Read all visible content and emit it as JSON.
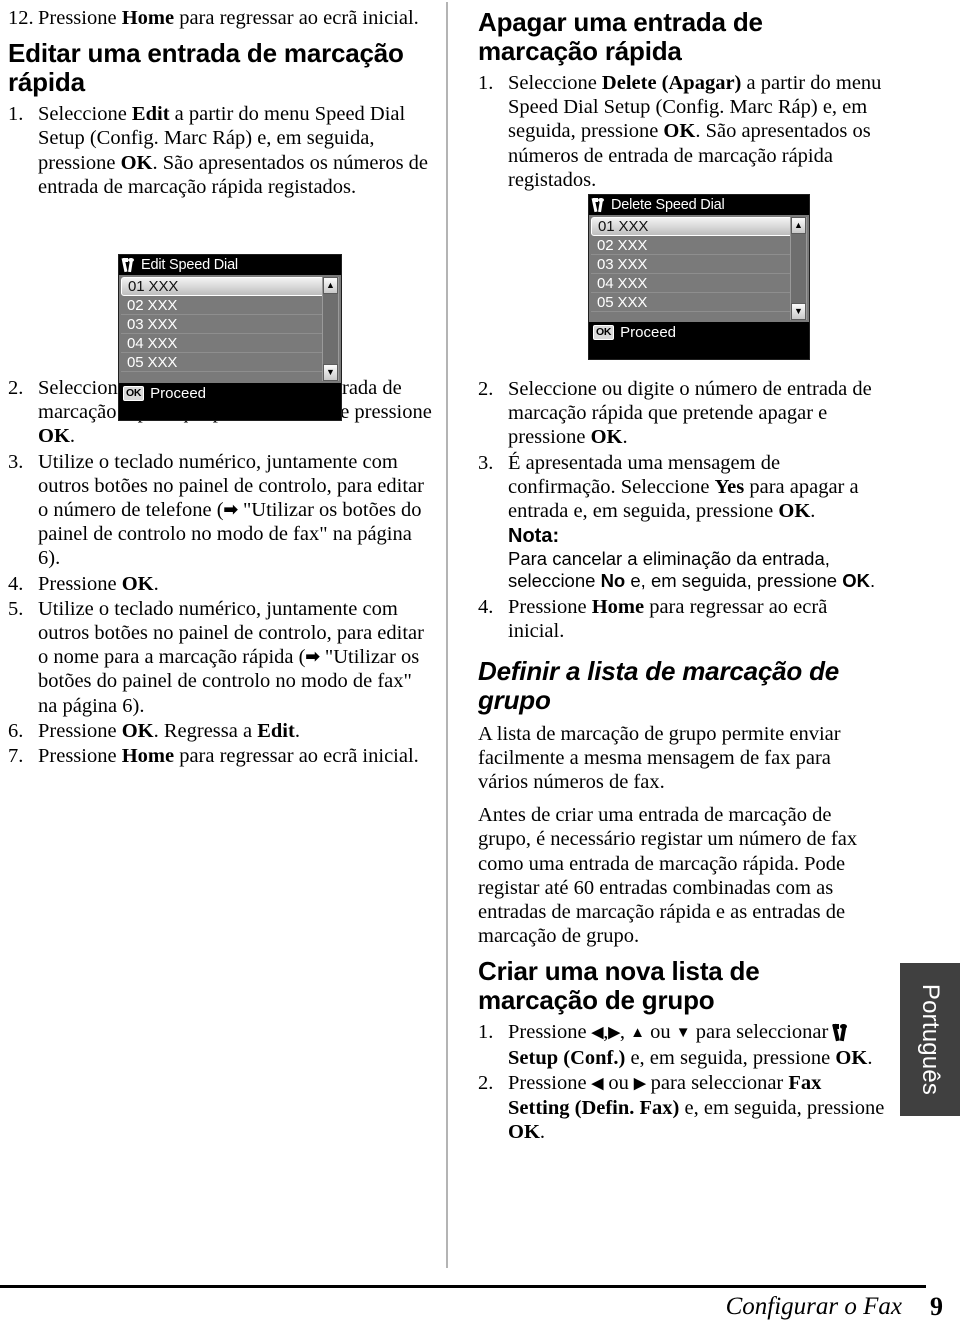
{
  "document": {
    "language_tab": "Português",
    "footer": {
      "section_title": "Configurar o Fax",
      "page_number": "9"
    }
  },
  "left_column": {
    "step_12": {
      "num": "12.",
      "text_before": "Pressione ",
      "bold_1": "Home",
      "text_after": " para regressar ao ecrã inicial."
    },
    "heading_edit": "Editar uma entrada de marcação rápida",
    "edit_steps": {
      "s1_num": "1.",
      "s1_a": "Seleccione ",
      "s1_b": "Edit",
      "s1_c": " a partir do menu Speed Dial Setup (Config. Marc Ráp) e, em seguida, pressione ",
      "s1_d": "OK",
      "s1_e": ". São apresentados os números de entrada de marcação rápida registados.",
      "s2_num": "2.",
      "s2_a": "Seleccione ou digite o número de entrada de marcação rápida que pretende editar e pressione ",
      "s2_b": "OK",
      "s2_c": ".",
      "s3_num": "3.",
      "s3_a": "Utilize o teclado numérico, juntamente com outros botões no painel de controlo, para editar o número de telefone (",
      "s3_arrow": "➡",
      "s3_b": " \"Utilizar os botões do painel de controlo no modo de fax\" na página 6).",
      "s4_num": "4.",
      "s4_a": "Pressione ",
      "s4_b": "OK",
      "s4_c": ".",
      "s5_num": "5.",
      "s5_a": "Utilize o teclado numérico, juntamente com outros botões no painel de controlo, para editar o nome para a marcação rápida (",
      "s5_arrow": "➡",
      "s5_b": " \"Utilizar os botões do painel de controlo no modo de fax\" na página 6).",
      "s6_num": "6.",
      "s6_a": "Pressione ",
      "s6_b": "OK",
      "s6_c": ". Regressa a ",
      "s6_d": "Edit",
      "s6_e": ".",
      "s7_num": "7.",
      "s7_a": "Pressione ",
      "s7_b": "Home",
      "s7_c": " para regressar ao ecrã inicial."
    },
    "lcd": {
      "title": "Edit Speed Dial",
      "icon": "wrench-icon",
      "rows": [
        "01 XXX",
        "02 XXX",
        "03 XXX",
        "04 XXX",
        "05 XXX"
      ],
      "selected_index": 0,
      "scroll_up_glyph": "▲",
      "scroll_down_glyph": "▼",
      "ok_key": "OK",
      "footer_label": "Proceed"
    }
  },
  "right_column": {
    "heading_delete": "Apagar uma entrada de marcação rápida",
    "delete_steps": {
      "s1_num": "1.",
      "s1_a": "Seleccione ",
      "s1_b": "Delete (Apagar)",
      "s1_c": " a partir do menu Speed Dial Setup (Config. Marc Ráp) e, em seguida, pressione ",
      "s1_d": "OK",
      "s1_e": ". São apresentados os números de entrada de marcação rápida registados.",
      "s2_num": "2.",
      "s2_a": "Seleccione ou digite o número de entrada de marcação rápida que pretende apagar e pressione ",
      "s2_b": "OK",
      "s2_c": ".",
      "s3_num": "3.",
      "s3_a": "É apresentada uma mensagem de confirmação. Seleccione ",
      "s3_b": "Yes",
      "s3_c": " para apagar a entrada e, em seguida, pressione ",
      "s3_d": "OK",
      "s3_e": ".",
      "note_label": "Nota:",
      "note_a": "Para cancelar a eliminação da entrada, seleccione ",
      "note_b": "No",
      "note_c": " e, em seguida, pressione ",
      "note_d": "OK",
      "note_e": ".",
      "s4_num": "4.",
      "s4_a": "Pressione ",
      "s4_b": "Home",
      "s4_c": " para regressar ao ecrã inicial."
    },
    "lcd": {
      "title": "Delete Speed Dial",
      "icon": "wrench-icon",
      "rows": [
        "01 XXX",
        "02 XXX",
        "03 XXX",
        "04 XXX",
        "05 XXX"
      ],
      "selected_index": 0,
      "scroll_up_glyph": "▲",
      "scroll_down_glyph": "▼",
      "ok_key": "OK",
      "footer_label": "Proceed"
    },
    "heading_group": "Definir a lista de marcação de grupo",
    "group_para_1": "A lista de marcação de grupo permite enviar facilmente a mesma mensagem de fax para vários números de fax.",
    "group_para_2": "Antes de criar uma entrada de marcação de grupo, é necessário registar um número de fax como uma entrada de marcação rápida. Pode registar até 60 entradas combinadas com as entradas de marcação rápida e as entradas de marcação de grupo.",
    "heading_create": "Criar uma nova lista de marcação de grupo",
    "create_steps": {
      "s1_num": "1.",
      "s1_a": "Pressione ",
      "s1_left": "◀",
      "s1_comma1": ",",
      "s1_right": "▶",
      "s1_comma2": ", ",
      "s1_up": "▲",
      "s1_ou": " ou ",
      "s1_down": "▼",
      "s1_b": " para seleccionar ",
      "s1_setup": "Setup (Conf.)",
      "s1_c": " e, em seguida, pressione ",
      "s1_d": "OK",
      "s1_e": ".",
      "s2_num": "2.",
      "s2_a": "Pressione ",
      "s2_left": "◀",
      "s2_ou": " ou ",
      "s2_right": "▶",
      "s2_b": " para seleccionar ",
      "s2_c": "Fax Setting (Defin. Fax)",
      "s2_d": " e, em seguida, pressione ",
      "s2_e": "OK",
      "s2_f": "."
    }
  },
  "colors": {
    "lcd_background": "#7a7a7a",
    "lcd_bar": "#000000",
    "language_tab": "#404040",
    "divider": "#b4b4b4"
  }
}
